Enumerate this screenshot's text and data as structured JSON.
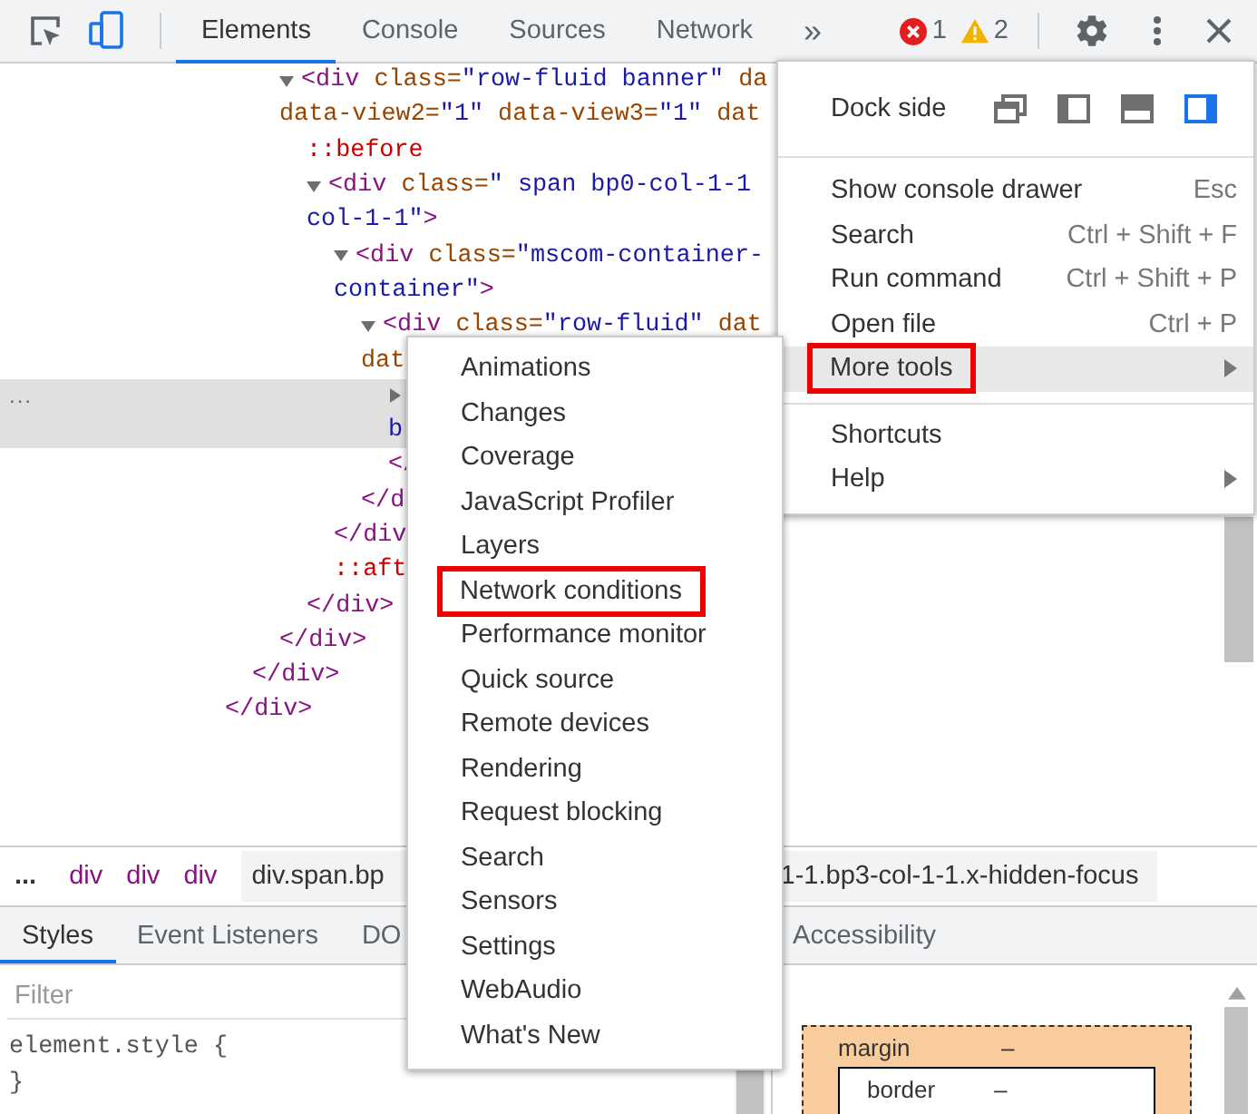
{
  "toolbar": {
    "tabs": [
      {
        "label": "Elements",
        "selected": true
      },
      {
        "label": "Console",
        "selected": false
      },
      {
        "label": "Sources",
        "selected": false
      },
      {
        "label": "Network",
        "selected": false
      }
    ],
    "overflow": "»",
    "errors": "1",
    "warnings": "2"
  },
  "dom_tree": {
    "nodes": [
      {
        "kind": "element",
        "children": [
          {
            "kind": "element",
            "children": [
              {
                "kind": "element",
                "expanded": true,
                "selected": false,
                "head": [
                  {
                    "kind": "tag",
                    "text": "<div"
                  },
                  {
                    "kind": "attr",
                    "text": " class="
                  },
                  {
                    "kind": "value",
                    "text": "\"row-fluid banner\""
                  },
                  {
                    "kind": "attr",
                    "text": " da"
                  }
                ],
                "wrap": [
                  [
                    {
                      "kind": "attr",
                      "text": "data-view2="
                    },
                    {
                      "kind": "value",
                      "text": "\"1\""
                    },
                    {
                      "kind": "attr",
                      "text": " data-view3="
                    },
                    {
                      "kind": "value",
                      "text": "\"1\""
                    },
                    {
                      "kind": "attr",
                      "text": " dat"
                    }
                  ]
                ],
                "children": [
                  {
                    "kind": "pseudo",
                    "text": "::before"
                  },
                  {
                    "kind": "element",
                    "expanded": true,
                    "selected": false,
                    "head": [
                      {
                        "kind": "tag",
                        "text": "<div"
                      },
                      {
                        "kind": "attr",
                        "text": " class="
                      },
                      {
                        "kind": "value",
                        "text": "\" span bp0-col-1-1"
                      }
                    ],
                    "wrap": [
                      [
                        {
                          "kind": "value",
                          "text": "col-1-1\""
                        },
                        {
                          "kind": "tag",
                          "text": ">"
                        }
                      ]
                    ],
                    "children": [
                      {
                        "kind": "element",
                        "expanded": true,
                        "selected": false,
                        "head": [
                          {
                            "kind": "tag",
                            "text": "<div"
                          },
                          {
                            "kind": "attr",
                            "text": " class="
                          },
                          {
                            "kind": "value",
                            "text": "\"mscom-container-"
                          }
                        ],
                        "wrap": [
                          [
                            {
                              "kind": "value",
                              "text": "container\""
                            },
                            {
                              "kind": "tag",
                              "text": ">"
                            }
                          ]
                        ],
                        "children": [
                          {
                            "kind": "element",
                            "expanded": true,
                            "selected": false,
                            "head": [
                              {
                                "kind": "tag",
                                "text": "<div"
                              },
                              {
                                "kind": "attr",
                                "text": " class="
                              },
                              {
                                "kind": "value",
                                "text": "\"row-fluid\""
                              },
                              {
                                "kind": "attr",
                                "text": " dat"
                              }
                            ],
                            "wrap": [
                              [
                                {
                                  "kind": "attr",
                                  "text": "dat"
                                }
                              ]
                            ],
                            "children": [
                              {
                                "kind": "element",
                                "expanded": false,
                                "selected": true,
                                "dots": "...",
                                "wrap": [
                                  [
                                    {
                                      "kind": "value",
                                      "text": "b"
                                    }
                                  ]
                                ]
                              },
                              {
                                "kind": "closing",
                                "text": "</"
                              }
                            ],
                            "close": "</d"
                          }
                        ],
                        "close": "</div"
                      },
                      {
                        "kind": "pseudo",
                        "text": "::aft"
                      }
                    ],
                    "close": "</div>"
                  }
                ],
                "close": "</div>"
              }
            ],
            "close": "</div>"
          }
        ],
        "close": "</div>"
      }
    ]
  },
  "breadcrumbs": {
    "more": "...",
    "items": [
      {
        "text": "div",
        "selected": false
      },
      {
        "text": "div",
        "selected": false
      },
      {
        "text": "div",
        "selected": false
      },
      {
        "text": "div.span.bp",
        "tail": "1-1.bp3-col-1-1.x-hidden-focus",
        "selected": true
      }
    ]
  },
  "panel_tabs": [
    {
      "label": "Styles",
      "selected": true
    },
    {
      "label": "Event Listeners",
      "selected": false
    },
    {
      "label": "DO",
      "selected": false
    },
    {
      "label": "Accessibility",
      "selected": false
    }
  ],
  "styles": {
    "filter_placeholder": "Filter",
    "rule_open": "element.style {",
    "rule_close": "}"
  },
  "box_model": {
    "margin_label": "margin",
    "margin_value": "–",
    "border_label": "border",
    "border_value": "–"
  },
  "main_menu": {
    "dock_side": {
      "label": "Dock side",
      "options": [
        {
          "kind": "undock",
          "selected": false
        },
        {
          "kind": "left",
          "selected": false
        },
        {
          "kind": "bottom",
          "selected": false
        },
        {
          "kind": "right",
          "selected": true
        }
      ]
    },
    "groups": [
      [
        {
          "label": "Show console drawer",
          "shortcut": "Esc",
          "submenu": false,
          "highlighted": false,
          "outlined": false
        },
        {
          "label": "Search",
          "shortcut": "Ctrl + Shift + F",
          "submenu": false,
          "highlighted": false,
          "outlined": false
        },
        {
          "label": "Run command",
          "shortcut": "Ctrl + Shift + P",
          "submenu": false,
          "highlighted": false,
          "outlined": false
        },
        {
          "label": "Open file",
          "shortcut": "Ctrl + P",
          "submenu": false,
          "highlighted": false,
          "outlined": false
        },
        {
          "label": "More tools",
          "submenu": true,
          "highlighted": true,
          "outlined": true
        }
      ],
      [
        {
          "label": "Shortcuts",
          "submenu": false,
          "highlighted": false,
          "outlined": false
        },
        {
          "label": "Help",
          "submenu": true,
          "highlighted": false,
          "outlined": false
        }
      ]
    ]
  },
  "more_tools_menu": [
    {
      "label": "Animations",
      "outlined": false
    },
    {
      "label": "Changes",
      "outlined": false
    },
    {
      "label": "Coverage",
      "outlined": false
    },
    {
      "label": "JavaScript Profiler",
      "outlined": false
    },
    {
      "label": "Layers",
      "outlined": false
    },
    {
      "label": "Network conditions",
      "outlined": true
    },
    {
      "label": "Performance monitor",
      "outlined": false
    },
    {
      "label": "Quick source",
      "outlined": false
    },
    {
      "label": "Remote devices",
      "outlined": false
    },
    {
      "label": "Rendering",
      "outlined": false
    },
    {
      "label": "Request blocking",
      "outlined": false
    },
    {
      "label": "Search",
      "outlined": false
    },
    {
      "label": "Sensors",
      "outlined": false
    },
    {
      "label": "Settings",
      "outlined": false
    },
    {
      "label": "WebAudio",
      "outlined": false
    },
    {
      "label": "What's New",
      "outlined": false
    }
  ]
}
